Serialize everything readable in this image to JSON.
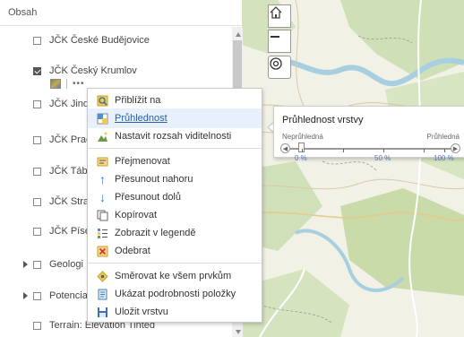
{
  "panel": {
    "title": "Obsah"
  },
  "layers": [
    {
      "label": "JČK České Budějovice",
      "checked": false
    },
    {
      "label": "JČK Český Krumlov",
      "checked": true
    },
    {
      "label": "JČK Jind",
      "checked": false
    },
    {
      "label": "JČK Prac",
      "checked": false
    },
    {
      "label": "JČK Tábo",
      "checked": false
    },
    {
      "label": "JČK Stra",
      "checked": false
    },
    {
      "label": "JČK Píse",
      "checked": false
    },
    {
      "label": "Geologi",
      "checked": false,
      "expandable": true
    },
    {
      "label": "Potencia",
      "checked": false,
      "expandable": true
    },
    {
      "label": "Terrain: Elevation Tinted",
      "checked": false
    }
  ],
  "legend": {
    "dots": "•••"
  },
  "context_menu": {
    "items": [
      {
        "label": "Přiblížit na",
        "icon": "zoom-to-icon",
        "glyph": "🔍"
      },
      {
        "label": "Průhlednost",
        "icon": "transparency-icon",
        "glyph": "▦"
      },
      {
        "label": "Nastavit rozsah viditelnosti",
        "icon": "visibility-range-icon",
        "glyph": "⛰"
      },
      {
        "label": "Přejmenovat",
        "icon": "rename-icon",
        "glyph": "✎"
      },
      {
        "label": "Přesunout nahoru",
        "icon": "arrow-up-icon",
        "glyph": "↑"
      },
      {
        "label": "Přesunout dolů",
        "icon": "arrow-down-icon",
        "glyph": "↓"
      },
      {
        "label": "Kopírovat",
        "icon": "copy-icon",
        "glyph": "⎘"
      },
      {
        "label": "Zobrazit v legendě",
        "icon": "legend-icon",
        "glyph": "☰"
      },
      {
        "label": "Odebrat",
        "icon": "remove-icon",
        "glyph": "✕"
      },
      {
        "label": "Směrovat ke všem prvkům",
        "icon": "navigate-features-icon",
        "glyph": "◈"
      },
      {
        "label": "Ukázat podrobnosti položky",
        "icon": "details-icon",
        "glyph": "▤"
      },
      {
        "label": "Uložit vrstvu",
        "icon": "save-icon",
        "glyph": "💾"
      }
    ]
  },
  "transparency": {
    "title": "Průhlednost vrstvy",
    "left_label": "Neprůhledná",
    "right_label": "Průhledná",
    "value_percent": 0,
    "ticks": [
      "0 %",
      "50 %",
      "100 %"
    ]
  },
  "map_controls": {
    "home": "home-icon",
    "zoom_out": "zoom-out-icon",
    "locate": "locate-icon"
  },
  "colors": {
    "accent": "#2a5fa6",
    "menu_active": "#e8f1fb",
    "water": "#a8cfe0",
    "forest": "#c9dcae"
  }
}
